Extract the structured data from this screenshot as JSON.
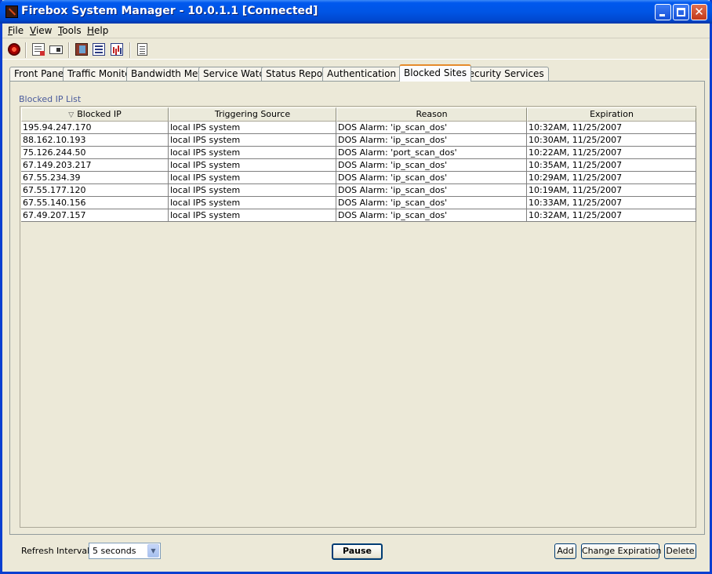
{
  "window": {
    "title": "Firebox System Manager - 10.0.1.1 [Connected]"
  },
  "menu": [
    {
      "key": "F",
      "rest": "ile"
    },
    {
      "key": "V",
      "rest": "iew"
    },
    {
      "key": "T",
      "rest": "ools"
    },
    {
      "key": "H",
      "rest": "elp"
    }
  ],
  "toolbar": {
    "icons": [
      "stop-icon",
      "document-report-icon",
      "card-icon",
      "hostwatch-icon",
      "list-icon",
      "performance-chart-icon",
      "clipboard-icon"
    ]
  },
  "tabs": [
    {
      "label": "Front Panel"
    },
    {
      "label": "Traffic Monitor"
    },
    {
      "label": "Bandwidth Meter"
    },
    {
      "label": "Service Watch"
    },
    {
      "label": "Status Report"
    },
    {
      "label": "Authentication List"
    },
    {
      "label": "Blocked Sites",
      "active": true
    },
    {
      "label": "Security Services"
    }
  ],
  "blocked_list": {
    "group_label": "Blocked IP List",
    "columns": [
      "Blocked IP",
      "Triggering Source",
      "Reason",
      "Expiration"
    ],
    "sort_indicator": "▽",
    "rows": [
      [
        "195.94.247.170",
        "local IPS system",
        "DOS Alarm: 'ip_scan_dos'",
        "10:32AM, 11/25/2007"
      ],
      [
        "88.162.10.193",
        "local IPS system",
        "DOS Alarm: 'ip_scan_dos'",
        "10:30AM, 11/25/2007"
      ],
      [
        "75.126.244.50",
        "local IPS system",
        "DOS Alarm: 'port_scan_dos'",
        "10:22AM, 11/25/2007"
      ],
      [
        "67.149.203.217",
        "local IPS system",
        "DOS Alarm: 'ip_scan_dos'",
        "10:35AM, 11/25/2007"
      ],
      [
        "67.55.234.39",
        "local IPS system",
        "DOS Alarm: 'ip_scan_dos'",
        "10:29AM, 11/25/2007"
      ],
      [
        "67.55.177.120",
        "local IPS system",
        "DOS Alarm: 'ip_scan_dos'",
        "10:19AM, 11/25/2007"
      ],
      [
        "67.55.140.156",
        "local IPS system",
        "DOS Alarm: 'ip_scan_dos'",
        "10:33AM, 11/25/2007"
      ],
      [
        "67.49.207.157",
        "local IPS system",
        "DOS Alarm: 'ip_scan_dos'",
        "10:32AM, 11/25/2007"
      ]
    ]
  },
  "footer": {
    "refresh_label": "Refresh Interval:",
    "refresh_value": "5 seconds",
    "pause_label": "Pause",
    "add_label": "Add",
    "change_label": "Change Expiration",
    "delete_label": "Delete"
  },
  "colors": {
    "titlebar": "#0055e5",
    "group_label": "#4a5b9c",
    "active_tab_accent": "#e68b2c"
  }
}
